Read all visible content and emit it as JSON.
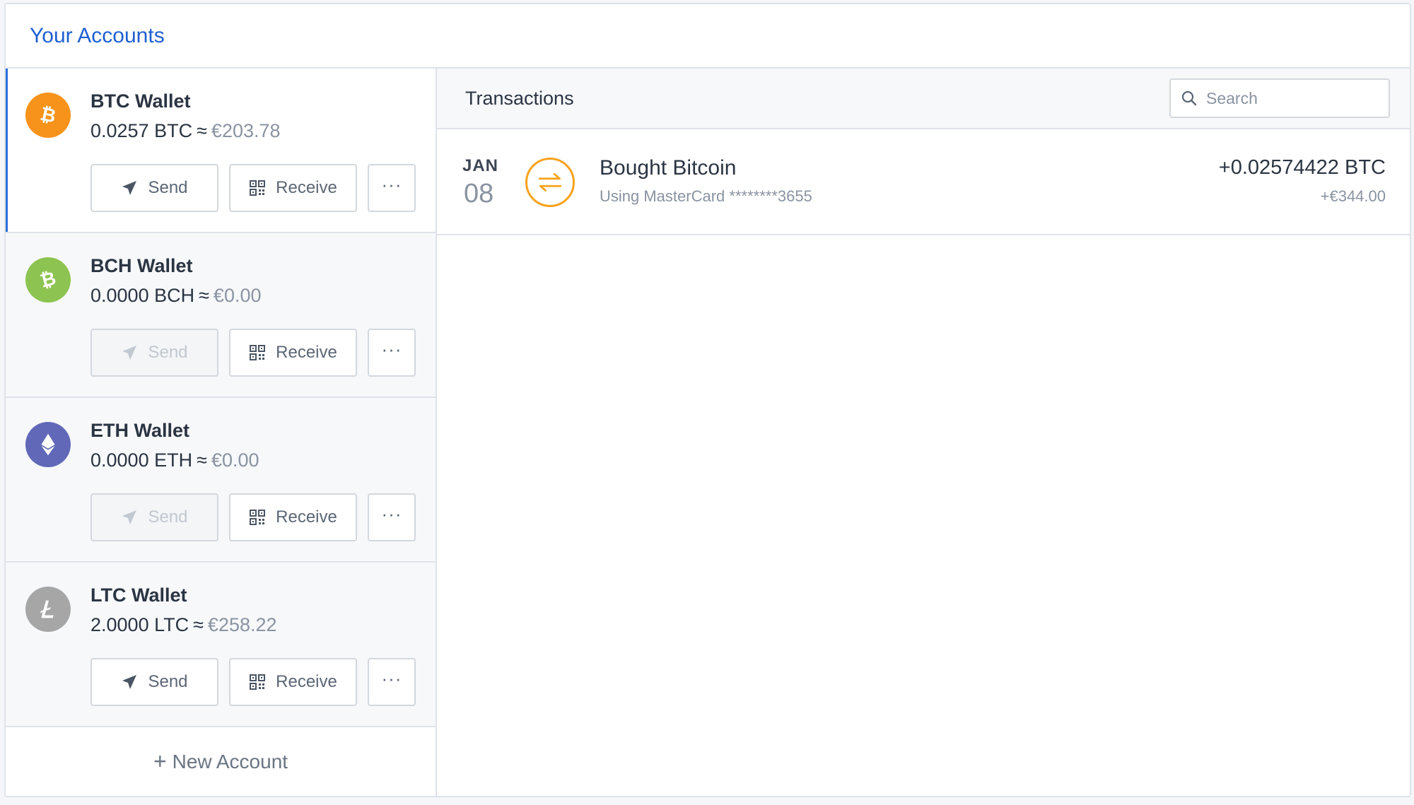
{
  "header": {
    "title": "Your Accounts"
  },
  "accounts": [
    {
      "name": "BTC Wallet",
      "amount": "0.0257 BTC",
      "approx": "≈",
      "fiat": "€203.78",
      "coin_color": "#f7931a",
      "icon": "bitcoin-icon",
      "selected": true,
      "send_disabled": false
    },
    {
      "name": "BCH Wallet",
      "amount": "0.0000 BCH",
      "approx": "≈",
      "fiat": "€0.00",
      "coin_color": "#8dc351",
      "icon": "bitcoin-cash-icon",
      "selected": false,
      "send_disabled": true
    },
    {
      "name": "ETH Wallet",
      "amount": "0.0000 ETH",
      "approx": "≈",
      "fiat": "€0.00",
      "coin_color": "#6168b8",
      "icon": "ethereum-icon",
      "selected": false,
      "send_disabled": true
    },
    {
      "name": "LTC Wallet",
      "amount": "2.0000 LTC",
      "approx": "≈",
      "fiat": "€258.22",
      "coin_color": "#a6a6a6",
      "icon": "litecoin-icon",
      "selected": false,
      "send_disabled": false
    }
  ],
  "buttons": {
    "send": "Send",
    "receive": "Receive",
    "more": "···"
  },
  "new_account": {
    "plus": "+",
    "label": "New Account"
  },
  "transactions": {
    "title": "Transactions",
    "search": {
      "placeholder": "Search",
      "value": ""
    },
    "items": [
      {
        "month": "JAN",
        "day": "08",
        "description": "Bought Bitcoin",
        "subtext": "Using MasterCard ********3655",
        "amount": "+0.02574422 BTC",
        "fiat": "+€344.00",
        "icon": "exchange-arrows-icon",
        "icon_color": "#f7a21b"
      }
    ]
  }
}
